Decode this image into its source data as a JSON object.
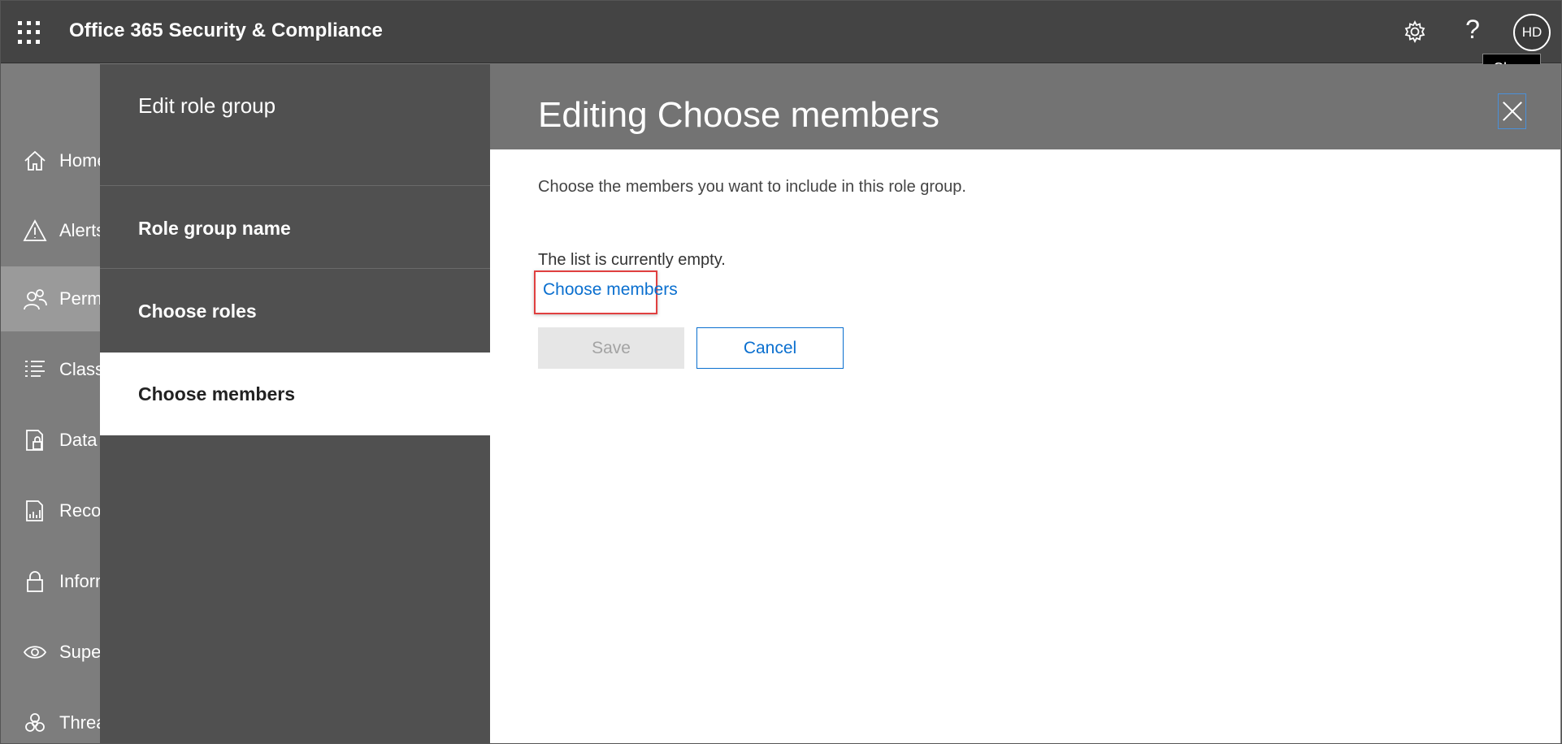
{
  "app": {
    "title": "Office 365 Security & Compliance",
    "avatar_initials": "HD",
    "help_glyph": "?"
  },
  "tooltip": {
    "text": "Close"
  },
  "leftnav": {
    "items": [
      {
        "label": "Home",
        "icon": "home-icon"
      },
      {
        "label": "Alerts",
        "icon": "alert-icon"
      },
      {
        "label": "Permissions",
        "icon": "people-icon"
      },
      {
        "label": "Classifications",
        "icon": "list-icon"
      },
      {
        "label": "Data loss prevention",
        "icon": "doc-lock-icon"
      },
      {
        "label": "Records management",
        "icon": "report-icon"
      },
      {
        "label": "Information governance",
        "icon": "lock-icon"
      },
      {
        "label": "Supervision",
        "icon": "eye-icon"
      },
      {
        "label": "Threat management",
        "icon": "biohazard-icon"
      }
    ]
  },
  "panel": {
    "heading": "Edit role group",
    "steps": [
      {
        "label": "Role group name"
      },
      {
        "label": "Choose roles"
      },
      {
        "label": "Choose members"
      }
    ],
    "title": "Editing Choose members",
    "description": "Choose the members you want to include in this role group.",
    "empty_text": "The list is currently empty.",
    "choose_link": "Choose members",
    "save_label": "Save",
    "cancel_label": "Cancel"
  },
  "colors": {
    "accent": "#0a6fcf",
    "highlight": "#e04040",
    "topbar": "#444444"
  }
}
